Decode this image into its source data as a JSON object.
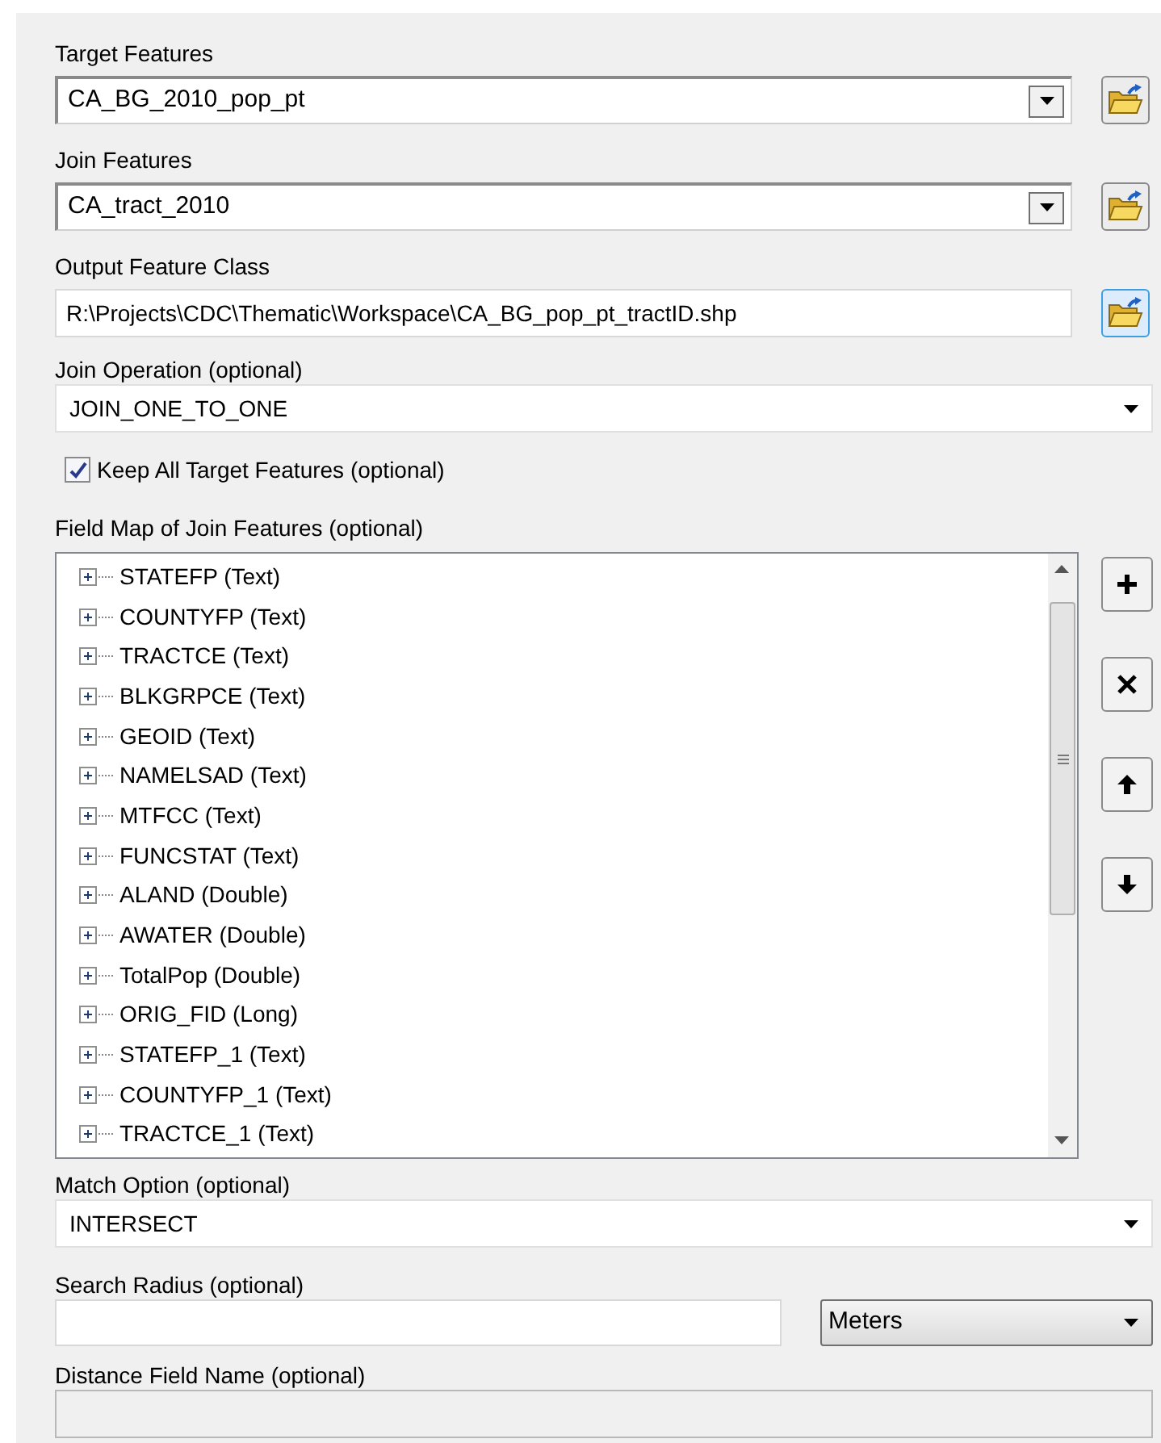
{
  "parameters": [
    {
      "kind": "combo_browse",
      "label": "Target Features",
      "value": "CA_BG_2010_pop_pt",
      "browse_focused": false
    },
    {
      "kind": "combo_browse",
      "label": "Join Features",
      "value": "CA_tract_2010",
      "browse_focused": false
    },
    {
      "kind": "text_browse",
      "label": "Output Feature Class",
      "value": "R:\\Projects\\CDC\\Thematic\\Workspace\\CA_BG_pop_pt_tractID.shp",
      "browse_focused": true
    },
    {
      "kind": "dropdown",
      "label": "Join Operation (optional)",
      "value": "JOIN_ONE_TO_ONE"
    },
    {
      "kind": "checkbox",
      "label": "Keep All Target Features (optional)",
      "checked": true
    },
    {
      "kind": "field_map",
      "label": "Field Map of Join Features (optional)",
      "items": [
        {
          "label": "STATEFP (Text)",
          "expanded": false
        },
        {
          "label": "COUNTYFP (Text)",
          "expanded": false
        },
        {
          "label": "TRACTCE (Text)",
          "expanded": false
        },
        {
          "label": "BLKGRPCE (Text)",
          "expanded": false
        },
        {
          "label": "GEOID (Text)",
          "expanded": false
        },
        {
          "label": "NAMELSAD (Text)",
          "expanded": false
        },
        {
          "label": "MTFCC (Text)",
          "expanded": false
        },
        {
          "label": "FUNCSTAT (Text)",
          "expanded": false
        },
        {
          "label": "ALAND (Double)",
          "expanded": false
        },
        {
          "label": "AWATER (Double)",
          "expanded": false
        },
        {
          "label": "TotalPop (Double)",
          "expanded": false
        },
        {
          "label": "ORIG_FID (Long)",
          "expanded": false
        },
        {
          "label": "STATEFP_1 (Text)",
          "expanded": false
        },
        {
          "label": "COUNTYFP_1 (Text)",
          "expanded": false
        },
        {
          "label": "TRACTCE_1 (Text)",
          "expanded": false
        }
      ]
    },
    {
      "kind": "dropdown",
      "label": "Match Option (optional)",
      "value": "INTERSECT"
    },
    {
      "kind": "text_unit",
      "label": "Search Radius (optional)",
      "unit": "Meters"
    },
    {
      "kind": "text",
      "label": "Distance Field Name (optional)",
      "disabled": true
    }
  ]
}
